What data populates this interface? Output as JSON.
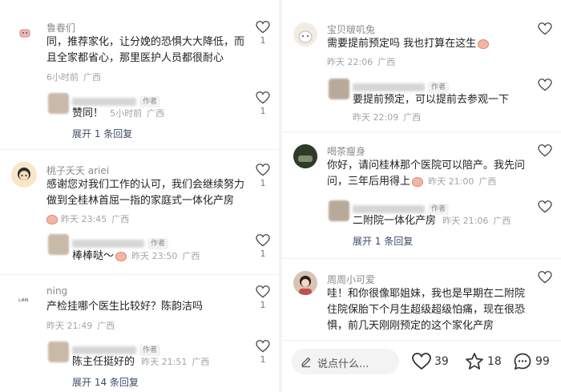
{
  "left": {
    "c1": {
      "name": "鲁春们",
      "text_lines": [
        "同，推荐家化，让分娩的恐惧大大降低，而",
        "且全家都省心，那里医护人员都很耐心"
      ],
      "time": "6小时前",
      "location": "广西",
      "likes": "1"
    },
    "r1": {
      "author_badge": "作者",
      "text": "赞同！",
      "time": "5小时前",
      "location": "广西",
      "likes": "1"
    },
    "more1": "展开 1 条回复",
    "c2": {
      "name": "桃子夭夭 ariei",
      "text_lines": [
        "感谢您对我们工作的认可，我们会继续努力",
        "做到全桂林首屈一指的家庭式一体化产房"
      ],
      "time": "昨天 23:45",
      "location": "广西",
      "likes": "1"
    },
    "r2": {
      "author_badge": "作者",
      "text": "棒棒哒～",
      "time": "昨天 23:50",
      "location": "广西",
      "likes": "1"
    },
    "c3": {
      "name": "ning",
      "text": "产检挂哪个医生比较好？陈韵洁吗",
      "time": "昨天 21:49",
      "location": "广西",
      "likes": "1"
    },
    "r3": {
      "author_badge": "作者",
      "text": "陈主任挺好的",
      "time": "昨天 21:51",
      "location": "广西",
      "likes": "1"
    },
    "more3": "展开 14 条回复"
  },
  "right": {
    "c1": {
      "name": "宝贝啵叽兔",
      "text": "需要提前预定吗 我也打算在这生",
      "time": "昨天 22:06",
      "location": "广西"
    },
    "r1": {
      "author_badge": "作者",
      "text": "要提前预定，可以提前去参观一下",
      "time": "昨天 22:09",
      "location": "广西"
    },
    "c2": {
      "name": "喝茶瘦身",
      "text_lines": [
        "你好，请问桂林那个医院可以陪产。我先问",
        "问，三年后用得上"
      ],
      "time": "昨天 21:00",
      "location": "广西"
    },
    "r2": {
      "author_badge": "作者",
      "text": "二附院一体化产房",
      "time": "昨天 21:06",
      "location": "广西"
    },
    "more2": "展开 1 条回复",
    "c3": {
      "name": "周周小可爱",
      "text_lines": [
        "哇！和你很像耶姐妹，我也是早期在二附院",
        "住院保胎下个月生超级超级怕痛，现在很恐",
        "惧，前几天刚刚预定的这个家化产房"
      ]
    }
  },
  "bottombar": {
    "input_placeholder": "说点什么...",
    "likes": "39",
    "favorites": "18",
    "comments": "99"
  },
  "icons": [
    "heart-icon",
    "star-icon",
    "chat-bubble-icon",
    "pen-icon"
  ]
}
